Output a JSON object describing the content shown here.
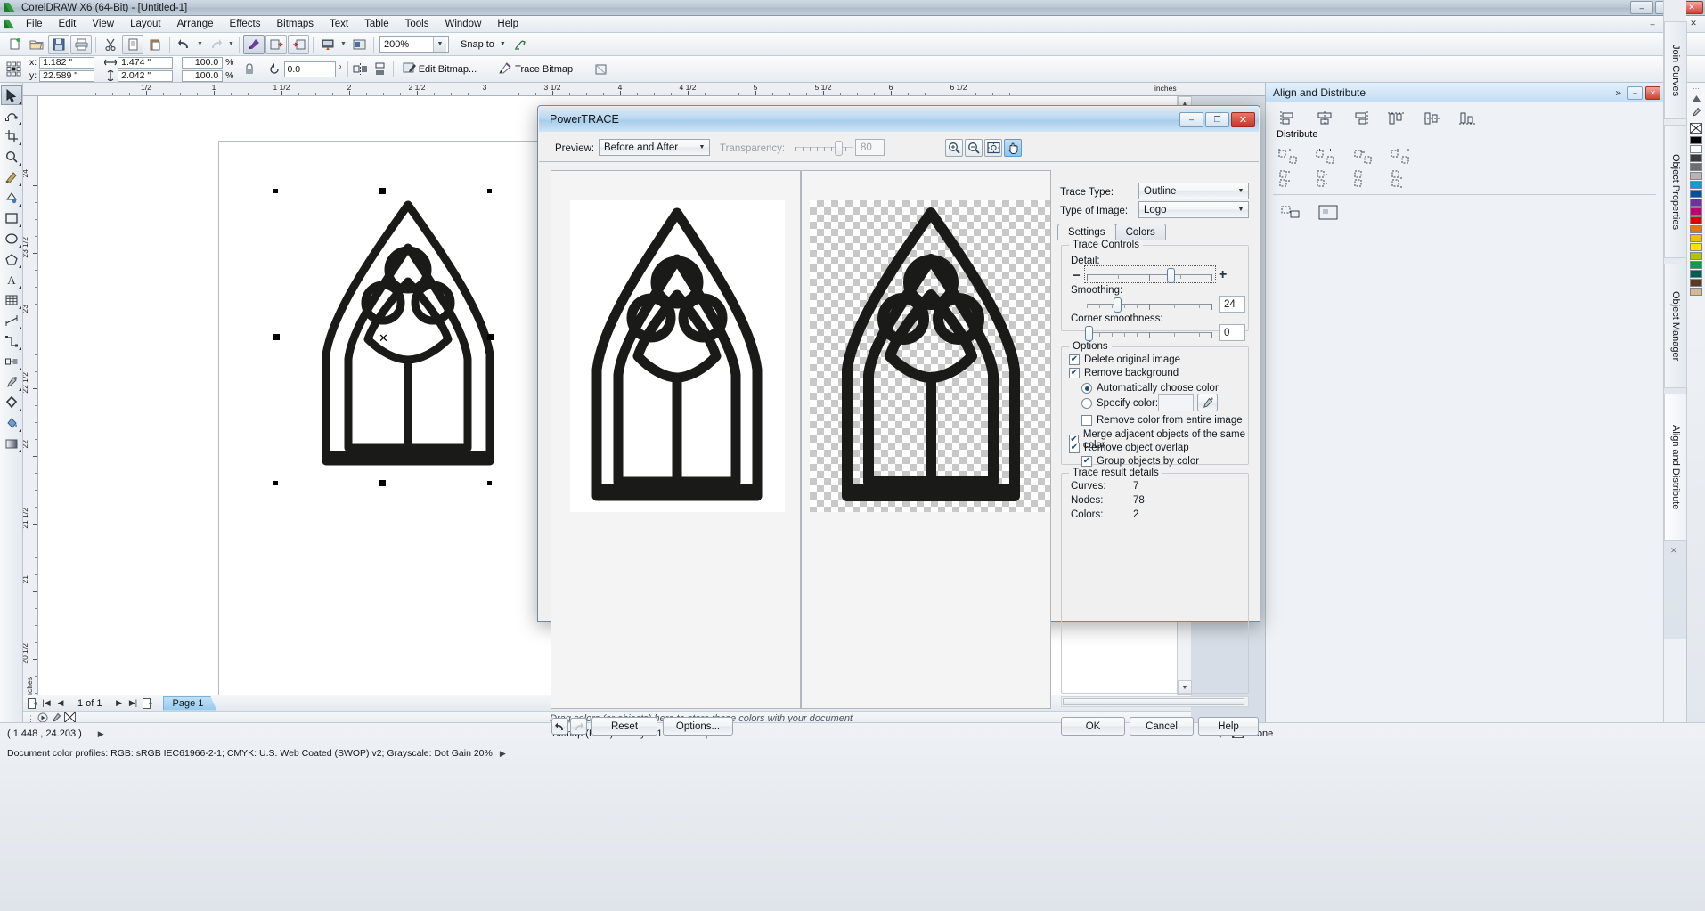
{
  "window": {
    "title": "CorelDRAW X6 (64-Bit) - [Untitled-1]",
    "app_icon": "coreldraw-icon",
    "minimize": "–",
    "maximize": "□",
    "close": "✕",
    "doc_minimize": "–",
    "doc_restore": "❐",
    "doc_close": "✕"
  },
  "menu": {
    "items": [
      "File",
      "Edit",
      "View",
      "Layout",
      "Arrange",
      "Effects",
      "Bitmaps",
      "Text",
      "Table",
      "Tools",
      "Window",
      "Help"
    ]
  },
  "standard_toolbar": {
    "buttons": [
      {
        "name": "new-document",
        "glyph": "new-icon"
      },
      {
        "name": "open-document",
        "glyph": "folder-icon"
      },
      {
        "name": "save-document",
        "glyph": "save-icon"
      },
      {
        "name": "print-document",
        "glyph": "print-icon"
      },
      {
        "name": "cut",
        "glyph": "scissors-icon"
      },
      {
        "name": "copy",
        "glyph": "copy-icon"
      },
      {
        "name": "paste",
        "glyph": "paste-icon"
      },
      {
        "name": "undo",
        "glyph": "undo-icon"
      },
      {
        "name": "redo",
        "glyph": "redo-icon"
      },
      {
        "name": "import",
        "glyph": "import-icon"
      },
      {
        "name": "export",
        "glyph": "export-icon"
      },
      {
        "name": "publish-pdf",
        "glyph": "pdf-icon"
      },
      {
        "name": "application-launcher",
        "glyph": "launcher-icon"
      }
    ],
    "zoom_level": "200%",
    "snap_to_label": "Snap to"
  },
  "property_bar": {
    "x_label": "x:",
    "x_value": "1.182 \"",
    "y_label": "y:",
    "y_value": "22.589 \"",
    "width_value": "1.474 \"",
    "height_value": "2.042 \"",
    "scale_h": "100.0",
    "scale_v": "100.0",
    "percent_symbol": "%",
    "rotation_value": "0.0",
    "degree_symbol": "°",
    "edit_bitmap": "Edit Bitmap...",
    "trace_bitmap": "Trace Bitmap"
  },
  "rulers": {
    "horizontal_labels": [
      "1/2",
      "1",
      "1 1/2",
      "2",
      "2 1/2",
      "3",
      "3 1/2",
      "4",
      "4 1/2",
      "5",
      "5 1/2",
      "6",
      "6 1/2"
    ],
    "vertical_labels": [
      "24",
      "23 1/2",
      "23",
      "22 1/2",
      "22",
      "21 1/2",
      "21",
      "20 1/2",
      "20"
    ],
    "units": "inches"
  },
  "toolbox": {
    "tools": [
      {
        "name": "pick-tool",
        "glyph": "arrow-icon",
        "selected": true
      },
      {
        "name": "shape-tool",
        "glyph": "node-icon"
      },
      {
        "name": "crop-tool",
        "glyph": "crop-icon"
      },
      {
        "name": "zoom-tool",
        "glyph": "magnifier-icon"
      },
      {
        "name": "freehand-tool",
        "glyph": "pencil-icon"
      },
      {
        "name": "smart-fill-tool",
        "glyph": "smartfill-icon"
      },
      {
        "name": "rectangle-tool",
        "glyph": "rectangle-icon"
      },
      {
        "name": "ellipse-tool",
        "glyph": "ellipse-icon"
      },
      {
        "name": "polygon-tool",
        "glyph": "polygon-icon"
      },
      {
        "name": "text-tool",
        "glyph": "text-icon"
      },
      {
        "name": "table-tool",
        "glyph": "table-icon"
      },
      {
        "name": "parallel-dimension-tool",
        "glyph": "dimension-icon"
      },
      {
        "name": "straight-line-connector-tool",
        "glyph": "connector-icon"
      },
      {
        "name": "blend-tool",
        "glyph": "blend-icon"
      },
      {
        "name": "color-eyedropper-tool",
        "glyph": "eyedropper-icon"
      },
      {
        "name": "outline-tool",
        "glyph": "outline-icon"
      },
      {
        "name": "fill-tool",
        "glyph": "fill-icon"
      },
      {
        "name": "interactive-fill-tool",
        "glyph": "interactive-fill-icon"
      }
    ]
  },
  "page_nav": {
    "page_counter": "1 of 1",
    "page_tab": "Page 1",
    "add_page_before": "add-page-icon",
    "first": "|◀",
    "prev": "◀",
    "next": "▶",
    "last": "▶|"
  },
  "palette_bar": {
    "hint": "Drag colors (or objects) here to store these colors with your document"
  },
  "status_bar": {
    "coordinates": "( 1.448 , 24.203 )",
    "object_info": "Bitmap (RGB) on Layer 1 72 x 72 dpi",
    "color_profile": "Document color profiles: RGB: sRGB IEC61966-2-1; CMYK: U.S. Web Coated (SWOP) v2; Grayscale: Dot Gain 20%",
    "fill_swatch": "None",
    "outline_swatch": "None",
    "none_label": "None"
  },
  "docker": {
    "title": "Align and Distribute",
    "distribute_label": "Distribute",
    "expand": "»",
    "minimize": "–",
    "close": "✕",
    "tabs": [
      {
        "label": "Join Curves",
        "active": false
      },
      {
        "label": "Object Properties",
        "active": false
      },
      {
        "label": "Object Manager",
        "active": false
      },
      {
        "label": "Align and Distribute",
        "active": true
      }
    ]
  },
  "powertrace": {
    "title": "PowerTRACE",
    "minimize": "–",
    "maximize": "❐",
    "close": "✕",
    "preview_label": "Preview:",
    "preview_mode": "Before and After",
    "transparency_label": "Transparency:",
    "transparency_value": "80",
    "zoom_in": "zoom-in-icon",
    "zoom_out": "zoom-out-icon",
    "zoom_fit": "zoom-fit-icon",
    "pan": "pan-hand-icon",
    "trace_type_label": "Trace Type:",
    "trace_type_value": "Outline",
    "type_of_image_label": "Type of Image:",
    "type_of_image_value": "Logo",
    "tabs": [
      {
        "label": "Settings",
        "active": true
      },
      {
        "label": "Colors",
        "active": false
      }
    ],
    "trace_controls": {
      "group_label": "Trace Controls",
      "detail_label": "Detail:",
      "detail_minus": "−",
      "detail_plus": "+",
      "smoothing_label": "Smoothing:",
      "smoothing_value": "24",
      "corner_smoothness_label": "Corner smoothness:",
      "corner_smoothness_value": "0"
    },
    "options": {
      "group_label": "Options",
      "delete_original_image": {
        "label": "Delete original image",
        "checked": true
      },
      "remove_background": {
        "label": "Remove background",
        "checked": true
      },
      "automatically_choose_color": {
        "label": "Automatically choose color",
        "selected": true
      },
      "specify_color": {
        "label": "Specify color:",
        "selected": false
      },
      "eyedropper": "eyedropper-icon",
      "remove_color_from_entire_image": {
        "label": "Remove color from entire image",
        "checked": false
      },
      "merge_adjacent_objects": {
        "label": "Merge adjacent objects of the same color",
        "checked": true
      },
      "remove_object_overlap": {
        "label": "Remove object overlap",
        "checked": true
      },
      "group_objects_by_color": {
        "label": "Group objects by color",
        "checked": true
      }
    },
    "trace_result_details": {
      "group_label": "Trace result details",
      "curves_label": "Curves:",
      "curves_value": "7",
      "nodes_label": "Nodes:",
      "nodes_value": "78",
      "colors_label": "Colors:",
      "colors_value": "2"
    },
    "footer": {
      "undo": "undo-icon",
      "redo": "redo-icon",
      "reset": "Reset",
      "options": "Options...",
      "ok": "OK",
      "cancel": "Cancel",
      "help": "Help"
    }
  },
  "colors": {
    "accent_blue": "#a8cdea",
    "title_blue": "#bcd9f0",
    "close_red": "#c33726",
    "window_bg": "#f0f0f0",
    "artwork_black": "#1a1a18"
  }
}
